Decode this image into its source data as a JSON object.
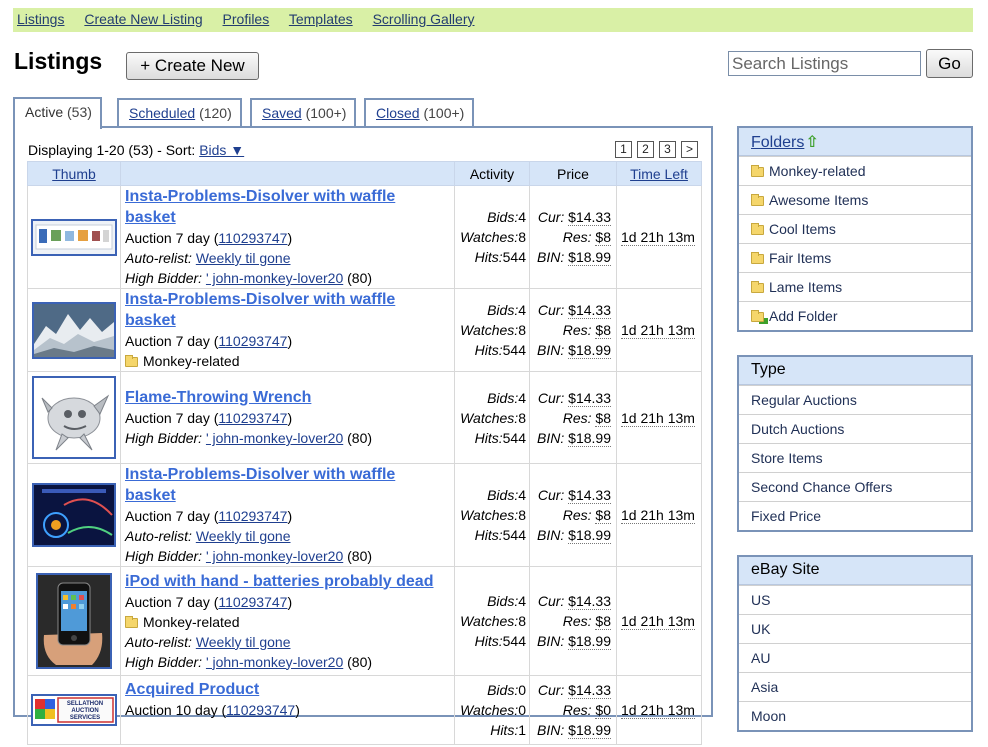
{
  "topnav": {
    "items": [
      "Listings",
      "Create New Listing",
      "Profiles",
      "Templates",
      "Scrolling Gallery"
    ]
  },
  "header": {
    "title": "Listings",
    "create_button": "+ Create New",
    "search_placeholder": "Search Listings",
    "go_button": "Go"
  },
  "tabs": [
    {
      "label": "Active",
      "count": "(53)"
    },
    {
      "label": "Scheduled",
      "count": "(120)"
    },
    {
      "label": "Saved",
      "count": "(100+)"
    },
    {
      "label": "Closed",
      "count": "(100+)"
    }
  ],
  "listing": {
    "display_text": "Displaying 1-20 (53) - Sort:",
    "sort_value": "Bids ▼",
    "pages": [
      "1",
      "2",
      "3",
      ">"
    ],
    "columns": {
      "thumb": "Thumb",
      "title": "",
      "activity": "Activity",
      "price": "Price",
      "time_left": "Time Left"
    },
    "rows": [
      {
        "title": "Insta-Problems-Disolver with waffle basket",
        "auction": "Auction 7 day (",
        "item_id": "110293747",
        "auction_close": ")",
        "autorelist_label": "Auto-relist:",
        "autorelist_value": "Weekly til gone",
        "bidder_label": "High Bidder:",
        "bidder_name": "' john-monkey-lover20",
        "bidder_score": "(80)",
        "bids_label": "Bids:",
        "bids": "4",
        "watches_label": "Watches:",
        "watches": "8",
        "hits_label": "Hits:",
        "hits": "544",
        "cur_label": "Cur:",
        "cur": "$14.33",
        "res_label": "Res:",
        "res": "$8",
        "bin_label": "BIN:",
        "bin": "$18.99",
        "time_left": "1d 21h 13m"
      },
      {
        "title": "Insta-Problems-Disolver with waffle basket",
        "auction": "Auction 7 day (",
        "item_id": "110293747",
        "auction_close": ")",
        "folder": "Monkey-related",
        "bids_label": "Bids:",
        "bids": "4",
        "watches_label": "Watches:",
        "watches": "8",
        "hits_label": "Hits:",
        "hits": "544",
        "cur_label": "Cur:",
        "cur": "$14.33",
        "res_label": "Res:",
        "res": "$8",
        "bin_label": "BIN:",
        "bin": "$18.99",
        "time_left": "1d 21h 13m"
      },
      {
        "title": "Flame-Throwing Wrench",
        "auction": "Auction 7 day (",
        "item_id": "110293747",
        "auction_close": ")",
        "bidder_label": "High Bidder:",
        "bidder_name": "' john-monkey-lover20",
        "bidder_score": "(80)",
        "bids_label": "Bids:",
        "bids": "4",
        "watches_label": "Watches:",
        "watches": "8",
        "hits_label": "Hits:",
        "hits": "544",
        "cur_label": "Cur:",
        "cur": "$14.33",
        "res_label": "Res:",
        "res": "$8",
        "bin_label": "BIN:",
        "bin": "$18.99",
        "time_left": "1d 21h 13m"
      },
      {
        "title": "Insta-Problems-Disolver with waffle basket",
        "auction": "Auction 7 day (",
        "item_id": "110293747",
        "auction_close": ")",
        "autorelist_label": "Auto-relist:",
        "autorelist_value": "Weekly til gone",
        "bidder_label": "High Bidder:",
        "bidder_name": "' john-monkey-lover20",
        "bidder_score": "(80)",
        "bids_label": "Bids:",
        "bids": "4",
        "watches_label": "Watches:",
        "watches": "8",
        "hits_label": "Hits:",
        "hits": "544",
        "cur_label": "Cur:",
        "cur": "$14.33",
        "res_label": "Res:",
        "res": "$8",
        "bin_label": "BIN:",
        "bin": "$18.99",
        "time_left": "1d 21h 13m"
      },
      {
        "title": "iPod with hand - batteries probably dead",
        "auction": "Auction 7 day (",
        "item_id": "110293747",
        "auction_close": ")",
        "folder": "Monkey-related",
        "autorelist_label": "Auto-relist:",
        "autorelist_value": "Weekly til gone",
        "bidder_label": "High Bidder:",
        "bidder_name": "' john-monkey-lover20",
        "bidder_score": "(80)",
        "bids_label": "Bids:",
        "bids": "4",
        "watches_label": "Watches:",
        "watches": "8",
        "hits_label": "Hits:",
        "hits": "544",
        "cur_label": "Cur:",
        "cur": "$14.33",
        "res_label": "Res:",
        "res": "$8",
        "bin_label": "BIN:",
        "bin": "$18.99",
        "time_left": "1d 21h 13m"
      },
      {
        "title": "Acquired Product",
        "auction": "Auction 10 day (",
        "item_id": "110293747",
        "auction_close": ")",
        "logo_text": [
          "SELLATHON",
          "AUCTION",
          "SERVICES"
        ],
        "bids_label": "Bids:",
        "bids": "0",
        "watches_label": "Watches:",
        "watches": "0",
        "hits_label": "Hits:",
        "hits": "1",
        "cur_label": "Cur:",
        "cur": "$14.33",
        "res_label": "Res:",
        "res": "$0",
        "bin_label": "BIN:",
        "bin": "$18.99",
        "time_left": "1d 21h 13m"
      }
    ]
  },
  "sidebar": {
    "folders": {
      "title": "Folders",
      "items": [
        "Monkey-related",
        "Awesome Items",
        "Cool Items",
        "Fair Items",
        "Lame Items",
        "Add Folder"
      ]
    },
    "type": {
      "title": "Type",
      "items": [
        "Regular Auctions",
        "Dutch Auctions",
        "Store Items",
        "Second Chance Offers",
        "Fixed Price"
      ]
    },
    "ebay_site": {
      "title": "eBay Site",
      "items": [
        "US",
        "UK",
        "AU",
        "Asia",
        "Moon"
      ]
    }
  },
  "colors": {
    "nav_bg": "#d9f0a6",
    "panel_border": "#7a93b8",
    "header_bg": "#d6e5f8",
    "link": "#1f3f8f",
    "title_link": "#3a6bd6"
  }
}
